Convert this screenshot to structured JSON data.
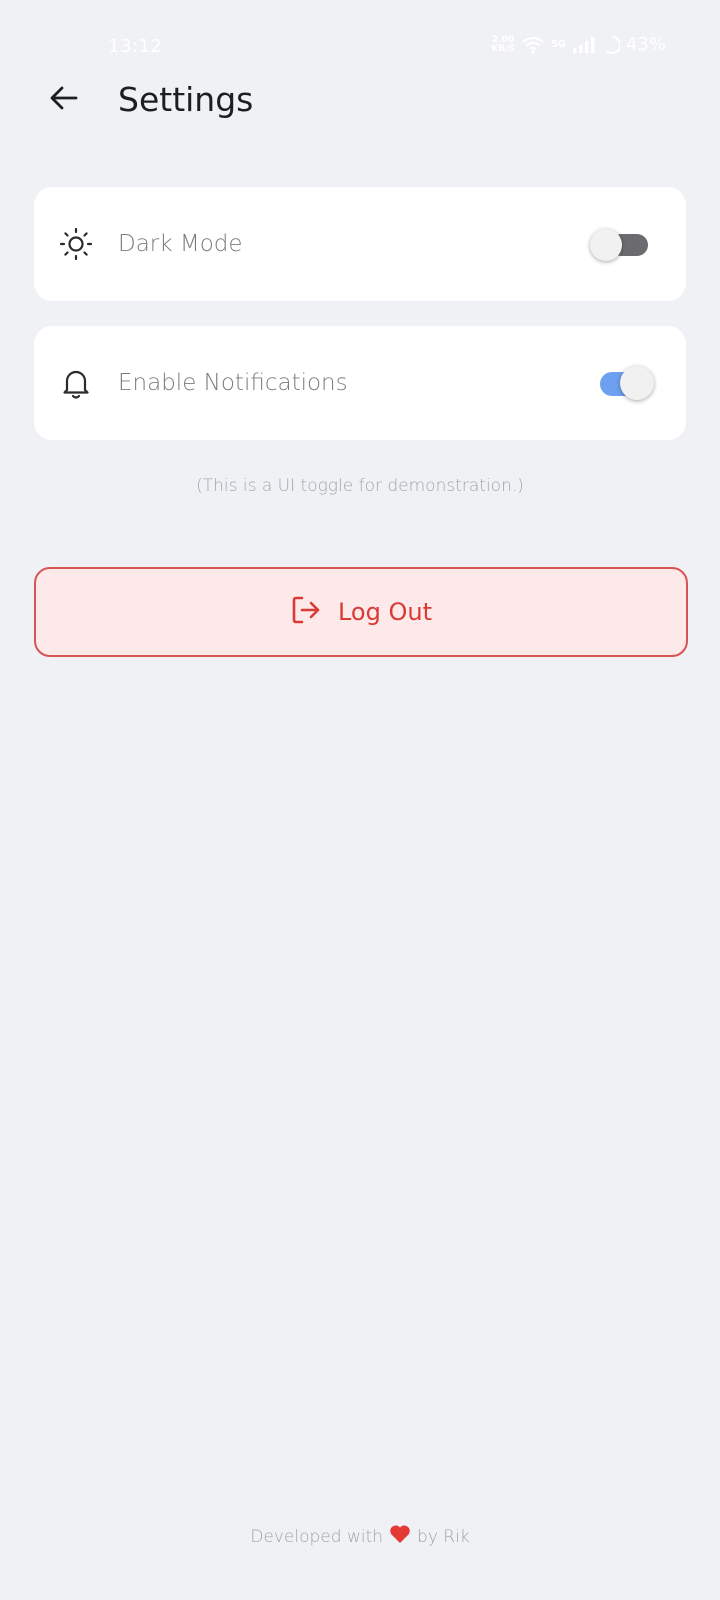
{
  "status_bar": {
    "time": "13:12",
    "speed_value": "2.00",
    "speed_unit": "KB/S",
    "network": "5G",
    "battery": "43%"
  },
  "header": {
    "title": "Settings",
    "back_icon": "arrow-left-icon"
  },
  "settings": {
    "dark_mode": {
      "label": "Dark Mode",
      "icon": "sun-icon",
      "enabled": false
    },
    "notifications": {
      "label": "Enable Notifications",
      "icon": "bell-icon",
      "enabled": true
    }
  },
  "hint": "(This is a UI toggle for demonstration.)",
  "logout": {
    "label": "Log Out",
    "icon": "logout-icon"
  },
  "footer": {
    "prefix": "Developed with",
    "heart_icon": "heart-icon",
    "suffix": "by Rik"
  },
  "colors": {
    "background": "#f0f1f5",
    "card": "#ffffff",
    "toggle_on": "#6ea0f0",
    "toggle_off": "#6c6c70",
    "logout_bg": "#fde8ea",
    "logout_accent": "#d93b34",
    "heart": "#e53935"
  }
}
